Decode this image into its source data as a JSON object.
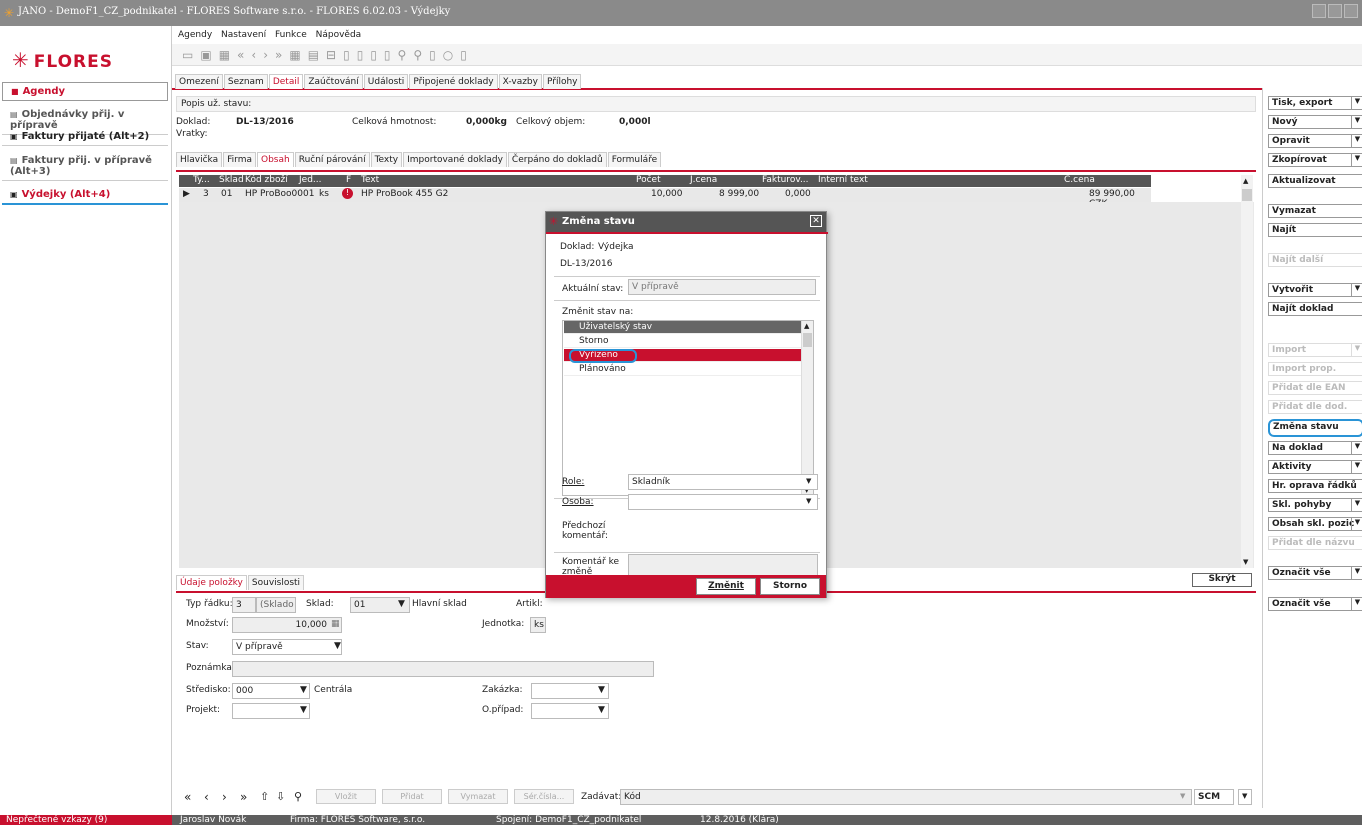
{
  "window": {
    "title": "JANO - DemoF1_CZ_podnikatel - FLORES Software s.r.o. - FLORES 6.02.03 - Výdejky"
  },
  "brand": {
    "name": "FLORES"
  },
  "colors": {
    "accent": "#c8102e",
    "highlight": "#2a94d6"
  },
  "menu": {
    "items": [
      "Agendy",
      "Nastavení",
      "Funkce",
      "Nápověda"
    ]
  },
  "sidebar": {
    "items": [
      {
        "label": "Agendy",
        "active": false
      },
      {
        "label": "Objednávky přij. v přípravě"
      },
      {
        "label": "Faktury přijaté (Alt+2)"
      },
      {
        "label": "Faktury přij. v přípravě (Alt+3)"
      },
      {
        "label": "Výdejky (Alt+4)",
        "active": true
      }
    ]
  },
  "tabs": [
    "Omezení",
    "Seznam",
    "Detail",
    "Zaúčtování",
    "Události",
    "Připojené doklady",
    "X-vazby",
    "Přílohy"
  ],
  "active_tab": "Detail",
  "status": {
    "label": "Popis už. stavu:"
  },
  "doc": {
    "doklad_label": "Doklad:",
    "doklad_value": "DL-13/2016",
    "vratky_label": "Vratky:",
    "hmotnost_label": "Celková hmotnost:",
    "hmotnost_value": "0,000kg",
    "objem_label": "Celkový objem:",
    "objem_value": "0,000l"
  },
  "subtabs": [
    "Hlavička",
    "Firma",
    "Obsah",
    "Ruční párování",
    "Texty",
    "Importované doklady",
    "Čerpáno do dokladů",
    "Formuláře"
  ],
  "active_subtab": "Obsah",
  "grid": {
    "headers": [
      "Ty...",
      "Sklad",
      "Kód zboží",
      "Jed...",
      "F",
      "Text",
      "Počet",
      "J.cena",
      "Fakturov...",
      "Interní text",
      "C.cena"
    ],
    "row": {
      "ty": "3",
      "sklad": "01",
      "kod": "HP ProBoo0001",
      "jed": "ks",
      "text": "HP ProBook 455 G2",
      "pocet": "10,000",
      "jcena": "8 999,00",
      "fakturov": "0,000",
      "ccena": "89 990,00 CZK"
    }
  },
  "bottom_tabs": [
    "Údaje položky",
    "Souvislosti"
  ],
  "item_form": {
    "typ_label": "Typ řádku:",
    "typ_value": "3",
    "typ_select": "(Sklado",
    "sklad_label": "Sklad:",
    "sklad_value": "01",
    "sklad_name": "Hlavní sklad",
    "artikl_label": "Artikl:",
    "mnozstvi_label": "Množství:",
    "mnozstvi_value": "10,000",
    "jednotka_label": "Jednotka:",
    "jednotka_value": "ks",
    "stav_label": "Stav:",
    "stav_value": "V přípravě",
    "poznamka_label": "Poznámka:",
    "stredisko_label": "Středisko:",
    "stredisko_value": "000",
    "stredisko_name": "Centrála",
    "zakazka_label": "Zakázka:",
    "projekt_label": "Projekt:",
    "opripad_label": "O.případ:",
    "skryt_label": "Skrýt"
  },
  "bottom_nav": {
    "buttons": [
      "Vložit",
      "Přidat",
      "Vymazat",
      "Sér.čísla..."
    ],
    "zadavat_label": "Zadávat:",
    "zadavat_value": "Kód",
    "scm_label": "SCM"
  },
  "right_buttons": [
    {
      "label": "Tisk, export",
      "dd": true
    },
    {
      "label": "Nový",
      "dd": true
    },
    {
      "label": "Opravit",
      "dd": true
    },
    {
      "label": "Zkopírovat",
      "dd": true
    },
    {
      "label": "Aktualizovat"
    },
    {
      "label": "Vymazat"
    },
    {
      "label": "Najít"
    },
    {
      "label": "Najít další",
      "disabled": true
    },
    {
      "label": "Vytvořit",
      "dd": true
    },
    {
      "label": "Najít doklad"
    },
    {
      "label": "Import",
      "dd": true,
      "disabled": true
    },
    {
      "label": "Import prop.",
      "disabled": true
    },
    {
      "label": "Přidat dle EAN",
      "disabled": true
    },
    {
      "label": "Přidat dle dod.",
      "disabled": true
    },
    {
      "label": "Změna stavu",
      "highlight": true
    },
    {
      "label": "Na doklad",
      "dd": true
    },
    {
      "label": "Aktivity",
      "dd": true
    },
    {
      "label": "Hr. oprava řádků"
    },
    {
      "label": "Skl. pohyby",
      "dd": true
    },
    {
      "label": "Obsah skl. pozic",
      "dd": true
    },
    {
      "label": "Přidat dle názvu",
      "disabled": true
    },
    {
      "label": "Označit vše",
      "dd": true
    },
    {
      "label": "Označit vše",
      "dd": true
    }
  ],
  "dialog": {
    "title": "Změna stavu",
    "doklad_label": "Doklad:",
    "doklad_type": "Výdejka",
    "doklad_number": "DL-13/2016",
    "aktualni_label": "Aktuální stav:",
    "aktualni_value": "V přípravě",
    "zmenit_label": "Změnit stav na:",
    "list_header": "Uživatelský stav",
    "options": [
      "Storno",
      "Vyřízeno",
      "Plánováno"
    ],
    "selected": "Vyřízeno",
    "role_label": "Role:",
    "role_value": "Skladník",
    "osoba_label": "Osoba:",
    "predchozi_label": "Předchozí komentář:",
    "komentar_label": "Komentář ke změně stavu:",
    "confirm_label": "Změnit",
    "cancel_label": "Storno"
  },
  "statusbar": {
    "unread": "Nepřečtené vzkazy (9)",
    "user": "Jaroslav Novák",
    "firma": "Firma: FLORES Software, s.r.o.",
    "spojeni": "Spojení: DemoF1_CZ_podnikatel",
    "date": "12.8.2016 (Klára)"
  }
}
